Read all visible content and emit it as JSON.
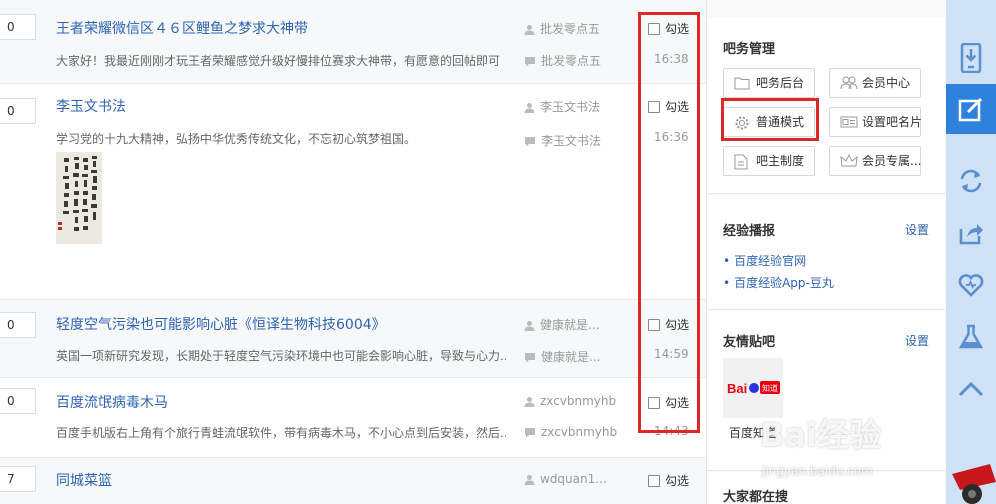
{
  "threads": [
    {
      "replies": "0",
      "title": "王者荣耀微信区４６区鲤鱼之梦求大神带",
      "abstract": "大家好！我最近刚刚才玩王者荣耀感觉升级好慢排位赛求大神带，有愿意的回帖即可",
      "author": "批发零点五",
      "last_reply_user": "批发零点五",
      "check_label": "勾选",
      "time": "16:38"
    },
    {
      "replies": "0",
      "title": "李玉文书法",
      "abstract": "学习党的十九大精神，弘扬中华优秀传统文化，不忘初心筑梦祖国。",
      "author": "李玉文书法",
      "last_reply_user": "李玉文书法",
      "check_label": "勾选",
      "time": "16:36",
      "image": "calligraphy-thumbnail"
    },
    {
      "replies": "0",
      "title": "轻度空气污染也可能影响心脏《恒译生物科技6004》",
      "abstract": "英国一项新研究发现，长期处于轻度空气污染环境中也可能会影响心脏，导致与心力...",
      "author": "健康就是...",
      "last_reply_user": "健康就是...",
      "check_label": "勾选",
      "time": "14:59"
    },
    {
      "replies": "0",
      "title": "百度流氓病毒木马",
      "abstract": "百度手机版右上角有个旅行青蛙流氓软件，带有病毒木马，不小心点到后安装，然后...",
      "author": "zxcvbnmyhb",
      "last_reply_user": "zxcvbnmyhb",
      "check_label": "勾选",
      "time": "14:43"
    },
    {
      "replies": "7",
      "title": "同城菜篮",
      "author": "wdquan1...",
      "check_label": "勾选"
    }
  ],
  "sidebar": {
    "management": {
      "title": "吧务管理",
      "buttons": [
        {
          "label": "吧务后台",
          "icon": "folder-icon"
        },
        {
          "label": "会员中心",
          "icon": "members-icon"
        },
        {
          "label": "普通模式",
          "icon": "gear-icon"
        },
        {
          "label": "设置吧名片",
          "icon": "card-icon"
        },
        {
          "label": "吧主制度",
          "icon": "document-icon"
        },
        {
          "label": "会员专属...",
          "icon": "crown-icon"
        }
      ]
    },
    "experience": {
      "title": "经验播报",
      "setting": "设置",
      "links": [
        "百度经验官网",
        "百度经验App-豆丸"
      ]
    },
    "friends": {
      "title": "友情贴吧",
      "setting": "设置",
      "item_name": "百度知道",
      "logo_text": "Bai知道"
    },
    "trending": {
      "title": "大家都在搜"
    }
  },
  "watermark": {
    "text": "Bai经验",
    "url": "jingyan.baidu.com"
  },
  "colors": {
    "link": "#2d64b3",
    "highlight": "#e02727",
    "toolbar_bg": "#cfe1f5",
    "toolbar_active": "#2e82dc"
  }
}
